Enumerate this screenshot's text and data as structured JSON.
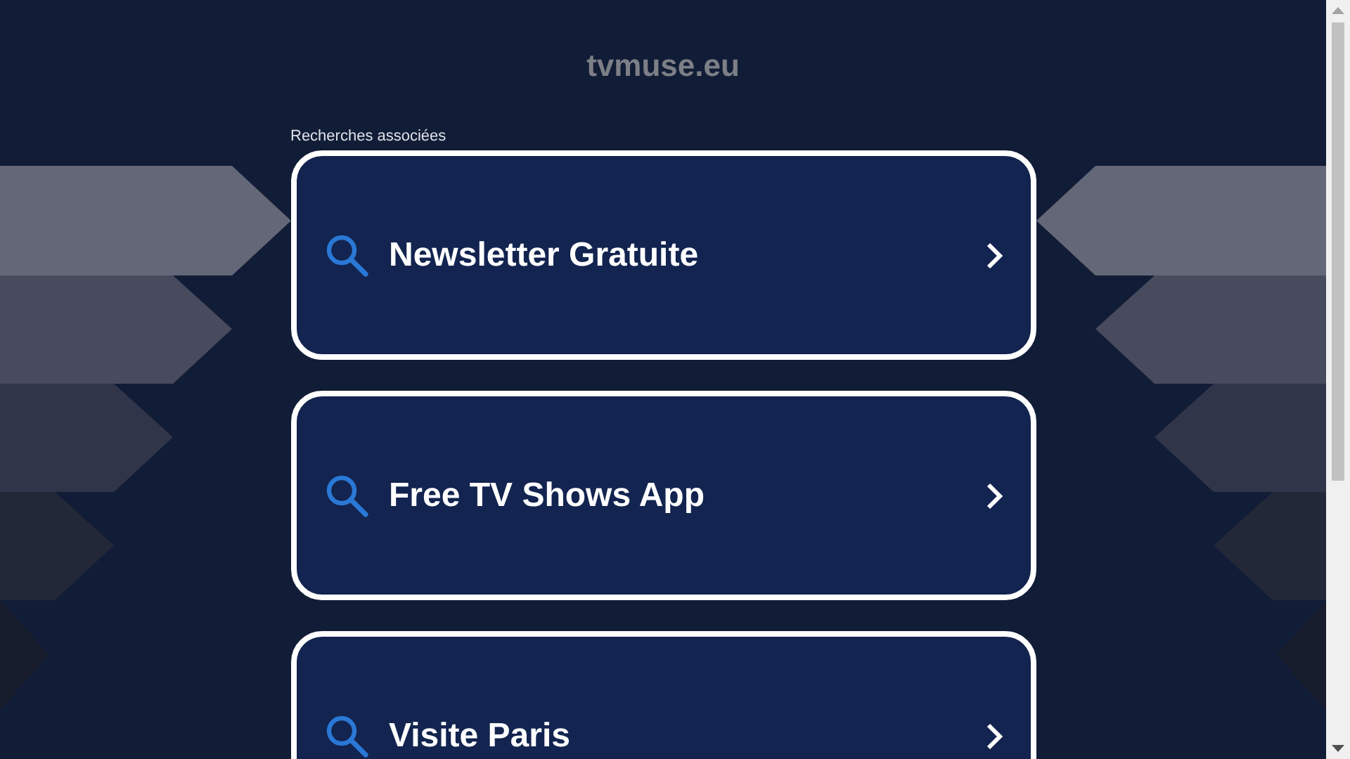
{
  "site_title": "tvmuse.eu",
  "related_label": "Recherches associées",
  "searches": [
    {
      "label": "Newsletter Gratuite"
    },
    {
      "label": "Free TV Shows App"
    },
    {
      "label": "Visite Paris"
    }
  ]
}
